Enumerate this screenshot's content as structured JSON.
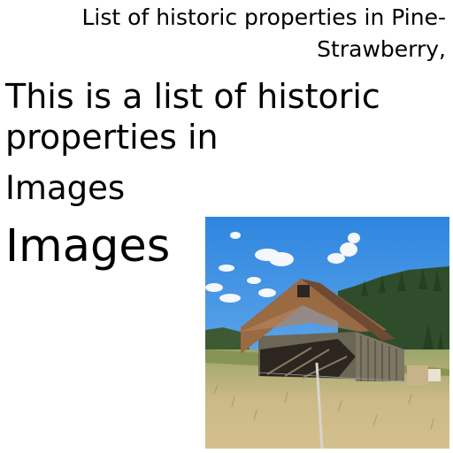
{
  "header": {
    "title": "List of historic properties in Pine-Strawberry,"
  },
  "body": {
    "intro": "This is a list of historic properties in",
    "images_label_small": "Images",
    "images_label_large": "Images"
  },
  "photo": {
    "subject": "weathered wooden barn with rusty tin roof",
    "colors": {
      "sky": "#3f8fe0",
      "forest": "#2f4f2a",
      "roof": "#9a6a43",
      "grass": "#c9b77a"
    }
  }
}
